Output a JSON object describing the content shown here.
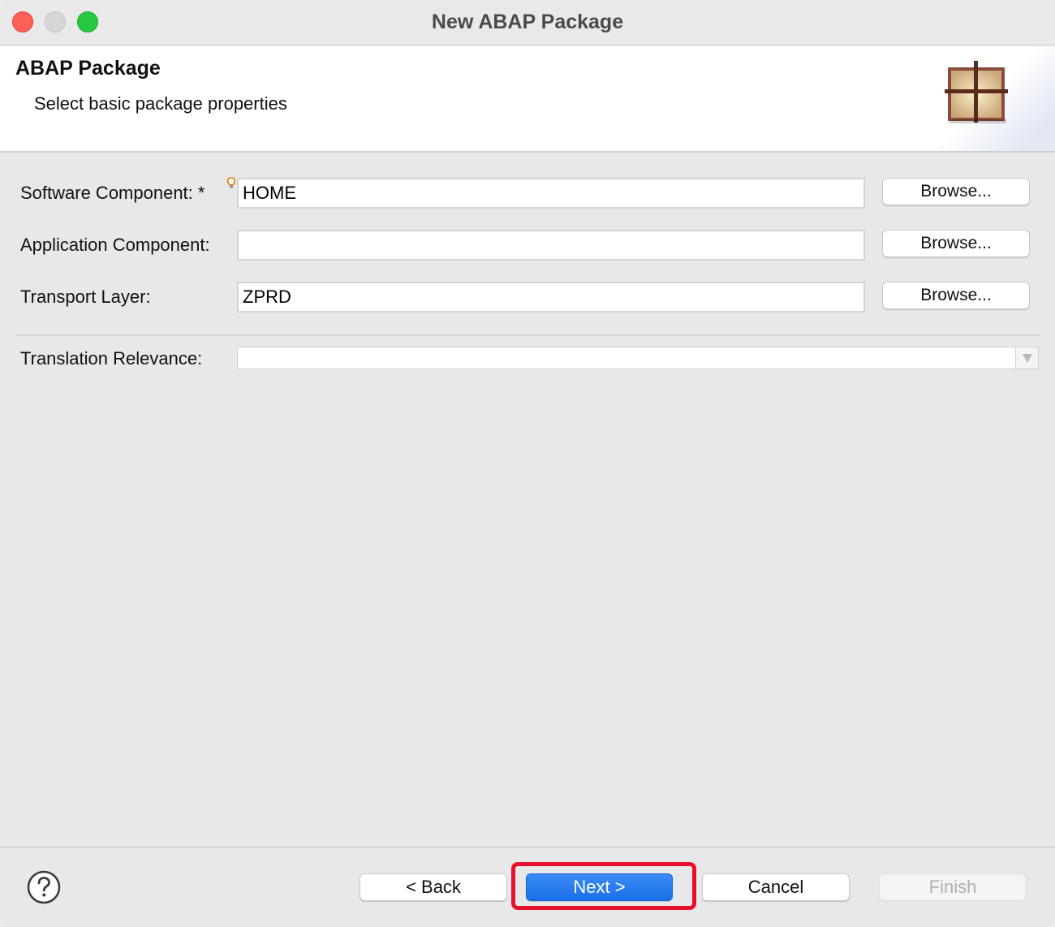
{
  "window": {
    "title": "New ABAP Package"
  },
  "banner": {
    "title": "ABAP Package",
    "subtitle": "Select basic package properties",
    "icon": "package-icon"
  },
  "form": {
    "software_component": {
      "label": "Software Component: *",
      "value": "HOME",
      "browse_label": "Browse..."
    },
    "application_component": {
      "label": "Application Component:",
      "value": "",
      "browse_label": "Browse..."
    },
    "transport_layer": {
      "label": "Transport Layer:",
      "value": "ZPRD",
      "browse_label": "Browse..."
    },
    "translation_relevance": {
      "label": "Translation Relevance:",
      "value": ""
    }
  },
  "footer": {
    "back_label": "< Back",
    "next_label": "Next >",
    "cancel_label": "Cancel",
    "finish_label": "Finish",
    "finish_enabled": false
  },
  "colors": {
    "primary_button": "#1a6fe8",
    "highlight": "#e8112d",
    "close": "#fe5f57",
    "maximize": "#28c840"
  }
}
